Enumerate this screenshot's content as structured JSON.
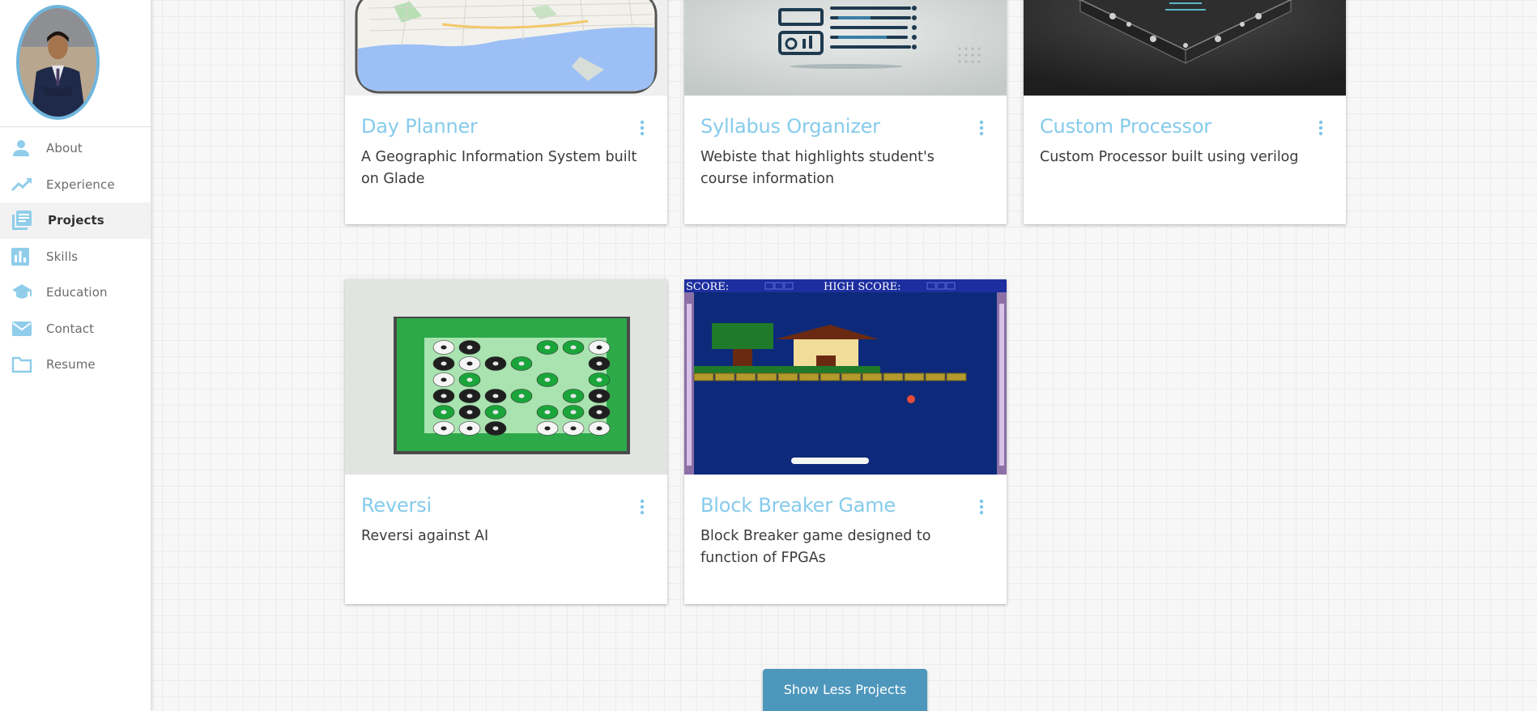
{
  "sidebar": {
    "items": [
      {
        "label": "About",
        "icon": "person-icon"
      },
      {
        "label": "Experience",
        "icon": "trending-up-icon"
      },
      {
        "label": "Projects",
        "icon": "library-books-icon"
      },
      {
        "label": "Skills",
        "icon": "bar-chart-icon"
      },
      {
        "label": "Education",
        "icon": "graduation-cap-icon"
      },
      {
        "label": "Contact",
        "icon": "mail-icon"
      },
      {
        "label": "Resume",
        "icon": "folder-icon"
      }
    ],
    "active_index": 2,
    "accent_color": "#6fb6de"
  },
  "projects": [
    {
      "title": "Day Planner",
      "description": "A Geographic Information System built on Glade",
      "image": "map-image"
    },
    {
      "title": "Syllabus Organizer",
      "description": "Webiste that highlights student's course information",
      "image": "dashboard-image"
    },
    {
      "title": "Custom Processor",
      "description": "Custom Processor built using verilog",
      "image": "chip-image"
    },
    {
      "title": "Reversi",
      "description": "Reversi against AI",
      "image": "reversi-board-image"
    },
    {
      "title": "Block Breaker Game",
      "description": "Block Breaker game designed to function of FPGAs",
      "image": "pixel-game-image"
    }
  ],
  "game_hud": {
    "score": "SCORE:",
    "high_score": "HIGH SCORE:"
  },
  "show_less_button": "Show Less Projects",
  "colors": {
    "title": "#86cbec",
    "button": "#4e97bc"
  }
}
